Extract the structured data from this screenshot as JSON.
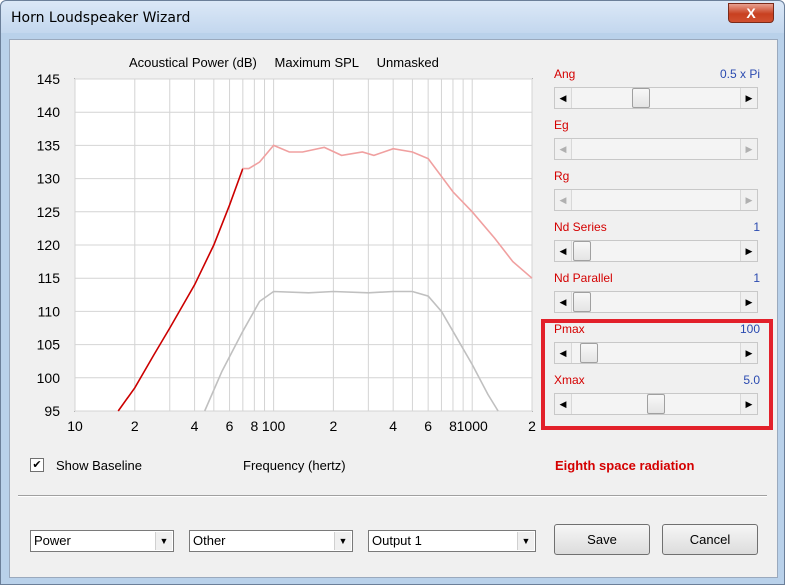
{
  "window": {
    "title": "Horn Loudspeaker Wizard",
    "close_glyph": "X"
  },
  "chart_header": {
    "part1": "Acoustical Power (dB)",
    "part2": "Maximum SPL",
    "part3": "Unmasked"
  },
  "chart_data": {
    "type": "line",
    "title": "Acoustical Power (dB)   Maximum SPL   Unmasked",
    "xlabel": "Frequency (hertz)",
    "ylabel": "",
    "x_scale": "log",
    "xlim": [
      10,
      2000
    ],
    "ylim": [
      95,
      145
    ],
    "y_ticks": [
      95,
      100,
      105,
      110,
      115,
      120,
      125,
      130,
      135,
      140,
      145
    ],
    "x_tick_labels": [
      "10",
      "2",
      "4",
      "6",
      "8",
      "100",
      "2",
      "4",
      "6",
      "8",
      "1000",
      "2"
    ],
    "grid": true,
    "series": [
      {
        "color": "#cc0000",
        "points": [
          [
            16.5,
            95
          ],
          [
            20,
            98.5
          ],
          [
            25,
            103.5
          ],
          [
            30,
            107.5
          ],
          [
            40,
            114
          ],
          [
            50,
            120
          ],
          [
            60,
            126
          ],
          [
            70,
            131.5
          ]
        ]
      },
      {
        "color": "#f0a0a0",
        "points": [
          [
            70,
            131.5
          ],
          [
            75,
            131.5
          ],
          [
            85,
            132.5
          ],
          [
            100,
            135
          ],
          [
            120,
            134
          ],
          [
            140,
            134
          ],
          [
            180,
            134.7
          ],
          [
            220,
            133.5
          ],
          [
            280,
            134
          ],
          [
            320,
            133.5
          ],
          [
            400,
            134.5
          ],
          [
            500,
            134
          ],
          [
            600,
            133
          ],
          [
            800,
            128
          ],
          [
            1000,
            125
          ],
          [
            1300,
            121
          ],
          [
            1600,
            117.5
          ],
          [
            2000,
            115
          ]
        ]
      },
      {
        "color": "#c0c0c0",
        "points": [
          [
            45,
            95
          ],
          [
            55,
            101
          ],
          [
            70,
            107
          ],
          [
            85,
            111.5
          ],
          [
            100,
            113
          ],
          [
            150,
            112.8
          ],
          [
            200,
            113
          ],
          [
            300,
            112.8
          ],
          [
            400,
            113
          ],
          [
            500,
            113
          ],
          [
            600,
            112.3
          ],
          [
            700,
            110
          ],
          [
            800,
            107
          ],
          [
            1000,
            102
          ],
          [
            1200,
            97.5
          ],
          [
            1350,
            95
          ]
        ]
      }
    ]
  },
  "sliders": [
    {
      "label": "Ang",
      "value": "0.5 x Pi",
      "level": 0.4,
      "enabled": true
    },
    {
      "label": "Eg",
      "value": "",
      "level": null,
      "enabled": false
    },
    {
      "label": "Rg",
      "value": "",
      "level": null,
      "enabled": false
    },
    {
      "label": "Nd  Series",
      "value": "1",
      "level": 0.0,
      "enabled": true
    },
    {
      "label": "Nd  Parallel",
      "value": "1",
      "level": 0.0,
      "enabled": true
    },
    {
      "label": "Pmax",
      "value": "100",
      "level": 0.05,
      "enabled": true
    },
    {
      "label": "Xmax",
      "value": "5.0",
      "level": 0.5,
      "enabled": true
    }
  ],
  "checkbox": {
    "label": "Show Baseline",
    "checked_glyph": "✔"
  },
  "xaxis_title": "Frequency (hertz)",
  "radiation": "Eighth space radiation",
  "combos": {
    "type": "Power",
    "mode": "Other",
    "output": "Output 1"
  },
  "buttons": {
    "save": "Save",
    "cancel": "Cancel"
  },
  "icons": {
    "left_arrow": "◀",
    "right_arrow": "▶",
    "down_arrow": "▼"
  }
}
